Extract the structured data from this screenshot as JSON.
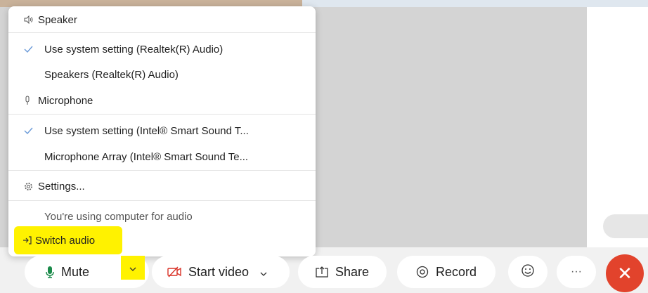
{
  "audio_menu": {
    "speaker_header": "Speaker",
    "speaker_options": [
      {
        "label": "Use system setting (Realtek(R) Audio)",
        "selected": true
      },
      {
        "label": "Speakers (Realtek(R) Audio)",
        "selected": false
      }
    ],
    "microphone_header": "Microphone",
    "microphone_options": [
      {
        "label": "Use system setting (Intel® Smart Sound T...",
        "selected": true
      },
      {
        "label": "Microphone Array (Intel® Smart Sound Te...",
        "selected": false
      }
    ],
    "settings_label": "Settings...",
    "status_text": "You're using computer for audio",
    "switch_audio_label": "Switch audio"
  },
  "toolbar": {
    "mute_label": "Mute",
    "start_video_label": "Start video",
    "share_label": "Share",
    "record_label": "Record",
    "more_label": "···",
    "end_label": "✕"
  },
  "icons": {
    "speaker": "speaker-icon",
    "microphone": "microphone-icon",
    "check": "check-icon",
    "settings": "gear-icon",
    "switch_audio": "switch-audio-icon",
    "video_off": "video-off-icon",
    "share": "share-icon",
    "record": "record-icon",
    "reactions": "emoji-icon",
    "more": "more-icon",
    "end_call": "close-icon",
    "chevron": "chevron-down-icon"
  },
  "colors": {
    "highlight": "#fff200",
    "end_call": "#e2432c",
    "check": "#6a9ad8",
    "mic_green": "#1a8a4a",
    "video_off_red": "#d93025"
  }
}
